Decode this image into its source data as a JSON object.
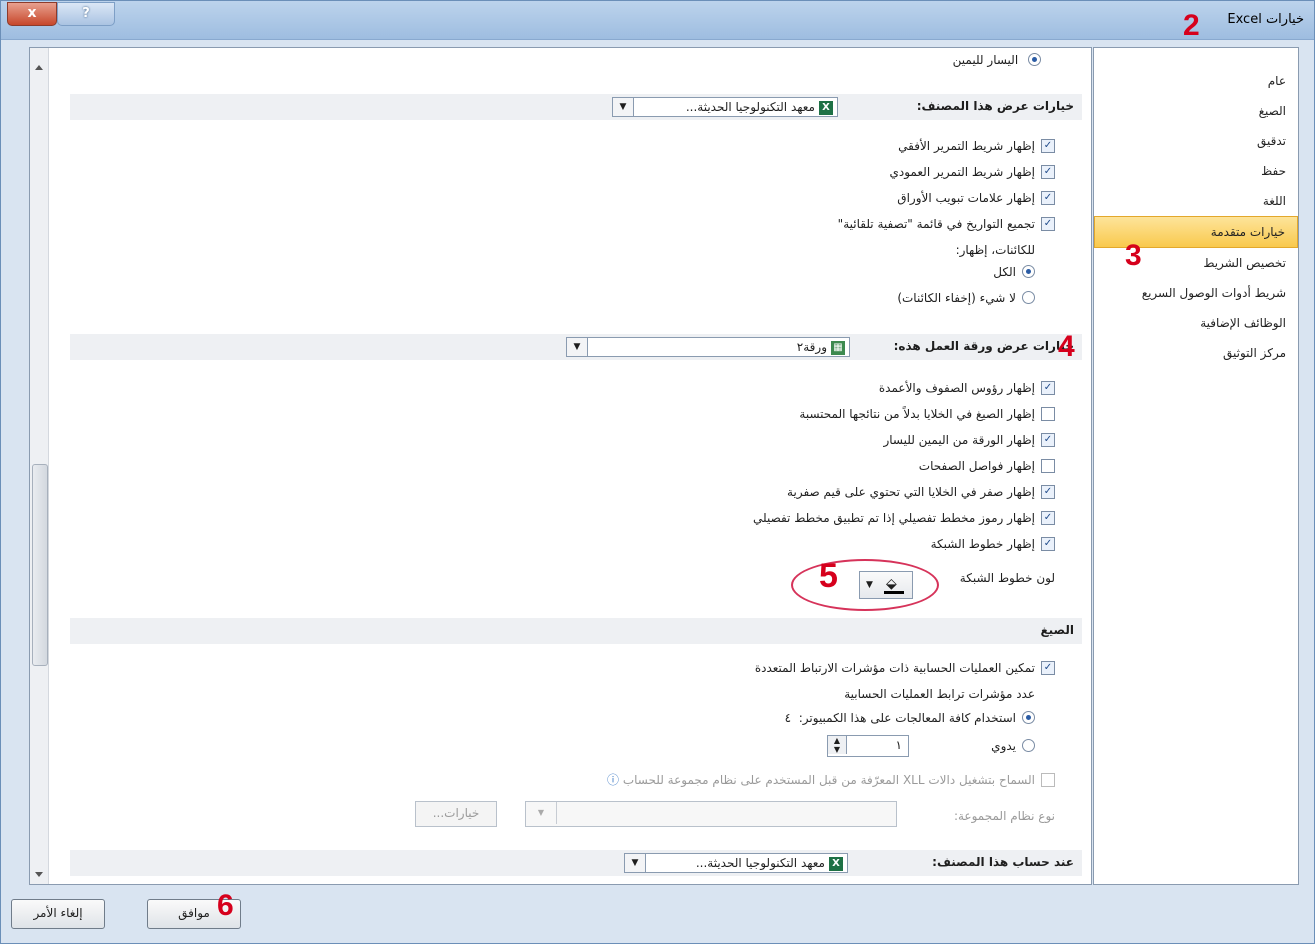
{
  "title": "خيارات Excel",
  "titlebar": {
    "close_label": "x",
    "help_label": "?"
  },
  "annotations": [
    "2",
    "3",
    "4",
    "5",
    "6"
  ],
  "nav": [
    {
      "label": "عام"
    },
    {
      "label": "الصيغ"
    },
    {
      "label": "تدقيق"
    },
    {
      "label": "حفظ"
    },
    {
      "label": "اللغة"
    },
    {
      "label": "خيارات متقدمة"
    },
    {
      "label": "تخصيص الشريط"
    },
    {
      "label": "شريط أدوات الوصول السريع"
    },
    {
      "label": "الوظائف الإضافية"
    },
    {
      "label": "مركز التوثيق"
    }
  ],
  "content": {
    "top_partial": "اليسار لليمين",
    "workbook_section": {
      "label": "خيارات عرض هذا المصنف:",
      "dropdown_value": "معهد التكنولوجيا الحديثة..."
    },
    "workbook_options": [
      {
        "label": "إظهار شريط التمرير الأفقي",
        "checked": true
      },
      {
        "label": "إظهار شريط التمرير العمودي",
        "checked": true
      },
      {
        "label": "إظهار علامات تبويب الأوراق",
        "checked": true
      },
      {
        "label": "تجميع التواريخ في قائمة \"تصفية تلقائية\"",
        "checked": true
      }
    ],
    "objects_label": "للكائنات، إظهار:",
    "objects_options": [
      {
        "label": "الكل",
        "selected": true
      },
      {
        "label": "لا شيء (إخفاء الكائنات)",
        "selected": false
      }
    ],
    "sheet_section": {
      "label": "خيارات عرض ورقة العمل هذه:",
      "dropdown_value": "ورقة٢"
    },
    "sheet_options": [
      {
        "label": "إظهار رؤوس الصفوف والأعمدة",
        "checked": true
      },
      {
        "label": "إظهار الصيغ في الخلايا بدلاً من نتائجها المحتسبة",
        "checked": false
      },
      {
        "label": "إظهار الورقة من اليمين لليسار",
        "checked": true
      },
      {
        "label": "إظهار فواصل الصفحات",
        "checked": false
      },
      {
        "label": "إظهار صفر في الخلايا التي تحتوي على قيم صفرية",
        "checked": true
      },
      {
        "label": "إظهار رموز مخطط تفصيلي إذا تم تطبيق مخطط تفصيلي",
        "checked": true
      },
      {
        "label": "إظهار خطوط الشبكة",
        "checked": true
      }
    ],
    "gridline_color_label": "لون خطوط الشبكة",
    "formulas_section": {
      "label": "الصيغ"
    },
    "formulas": {
      "multithread_label": "تمكين العمليات الحسابية ذات مؤشرات الارتباط المتعددة",
      "multithread_checked": true,
      "threads_label": "عدد مؤشرات ترابط العمليات الحسابية",
      "use_all_label": "استخدام كافة المعالجات على هذا الكمبيوتر:",
      "use_all_count": "٤",
      "manual_label": "يدوي",
      "manual_value": "١",
      "xll_label": "السماح بتشغيل دالات XLL المعرّفة من قبل المستخدم على نظام مجموعة للحساب",
      "cluster_type_label": "نوع نظام المجموعة:",
      "options_button": "خيارات..."
    },
    "calc_section": {
      "label": "عند حساب هذا المصنف:",
      "dropdown_value": "معهد التكنولوجيا الحديثة..."
    }
  },
  "footer": {
    "ok_label": "موافق",
    "cancel_label": "إلغاء الأمر"
  }
}
